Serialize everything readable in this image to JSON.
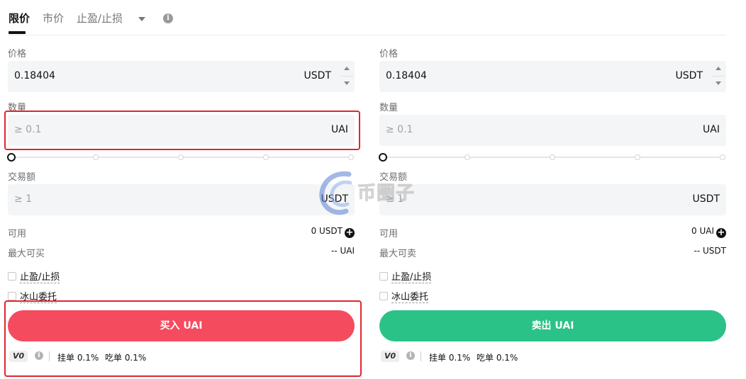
{
  "tabs": {
    "limit": "限价",
    "market": "市价",
    "tpsl": "止盈/止损"
  },
  "buy": {
    "price_label": "价格",
    "price_value": "0.18404",
    "price_unit": "USDT",
    "amount_label": "数量",
    "amount_placeholder": "≥ 0.1",
    "amount_unit": "UAI",
    "total_label": "交易额",
    "total_placeholder": "≥ 1",
    "total_unit": "USDT",
    "available_label": "可用",
    "available_value": "0 USDT",
    "max_label": "最大可买",
    "max_value": "-- UAI",
    "tpsl_label": "止盈/止损",
    "iceberg_label": "冰山委托",
    "button": "买入 UAI",
    "vip": "V0",
    "maker_fee": "挂单 0.1%",
    "taker_fee": "吃单 0.1%",
    "slider_percent": 0
  },
  "sell": {
    "price_label": "价格",
    "price_value": "0.18404",
    "price_unit": "USDT",
    "amount_label": "数量",
    "amount_placeholder": "≥ 0.1",
    "amount_unit": "UAI",
    "total_label": "交易额",
    "total_placeholder": "≥ 1",
    "total_unit": "USDT",
    "available_label": "可用",
    "available_value": "0 UAI",
    "max_label": "最大可卖",
    "max_value": "-- USDT",
    "tpsl_label": "止盈/止损",
    "iceberg_label": "冰山委托",
    "button": "卖出 UAI",
    "vip": "V0",
    "maker_fee": "挂单 0.1%",
    "taker_fee": "吃单 0.1%",
    "slider_percent": 0
  },
  "watermark": "币圈子",
  "colors": {
    "buy": "#f54b5e",
    "sell": "#2bc287",
    "highlight": "#e0252f"
  }
}
